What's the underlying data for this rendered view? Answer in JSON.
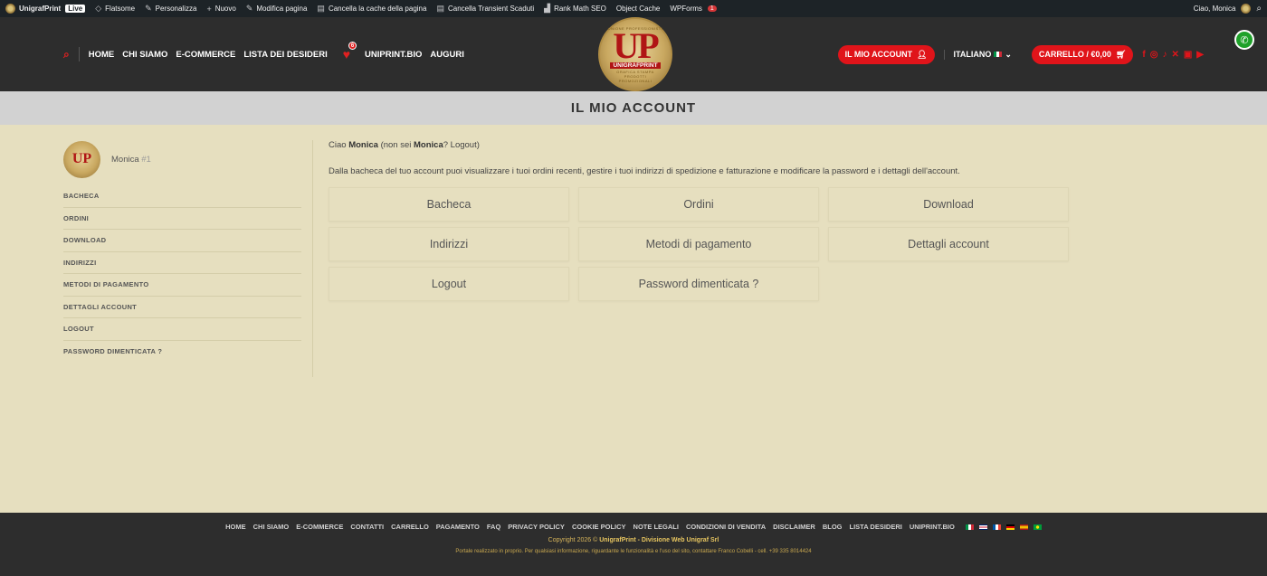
{
  "adminbar": {
    "site": "UnigrafPrint",
    "live": "Live",
    "items": [
      {
        "icon": "flatsome-icon",
        "glyph": "◇",
        "label": "Flatsome"
      },
      {
        "icon": "brush-icon",
        "glyph": "✎",
        "label": "Personalizza"
      },
      {
        "icon": "plus-icon",
        "glyph": "+",
        "label": "Nuovo"
      },
      {
        "icon": "pencil-icon",
        "glyph": "✎",
        "label": "Modifica pagina"
      },
      {
        "icon": "database-icon",
        "glyph": "▤",
        "label": "Cancella la cache della pagina"
      },
      {
        "icon": "database-icon",
        "glyph": "▤",
        "label": "Cancella Transient Scaduti"
      },
      {
        "icon": "rankmath-icon",
        "glyph": "▟",
        "label": "Rank Math SEO"
      },
      {
        "icon": "",
        "glyph": "",
        "label": "Object Cache"
      },
      {
        "icon": "",
        "glyph": "",
        "label": "WPForms"
      }
    ],
    "wpforms_badge": "1",
    "greeting": "Ciao, Monica"
  },
  "header": {
    "nav_left": [
      "HOME",
      "CHI SIAMO",
      "E-COMMERCE",
      "LISTA DEI DESIDERI"
    ],
    "wishlist_count": "6",
    "nav_right_links": [
      "UNIPRINT.BIO",
      "AUGURI"
    ],
    "logo": {
      "letters": "UP",
      "top": "UNIONE PROFESSIONISTI",
      "band": "UNIGRAFPRINT",
      "bottom": "GRAFICA STAMPA PRODOTTI PROMOZIONALI"
    },
    "account_label": "IL MIO ACCOUNT",
    "language": "ITALIANO",
    "cart_label": "CARRELLO / €0,00",
    "accent": "#e0141a"
  },
  "page": {
    "title": "IL MIO ACCOUNT"
  },
  "sidebar": {
    "user_name": "Monica",
    "user_id": "#1",
    "items": [
      "BACHECA",
      "ORDINI",
      "DOWNLOAD",
      "INDIRIZZI",
      "METODI DI PAGAMENTO",
      "DETTAGLI ACCOUNT",
      "LOGOUT",
      "PASSWORD DIMENTICATA ?"
    ]
  },
  "main": {
    "greeting_prefix": "Ciao",
    "name": "Monica",
    "greeting_mid": "(non sei",
    "name2": "Monica",
    "greeting_suffix": "? Logout)",
    "intro": "Dalla bacheca del tuo account puoi visualizzare i tuoi ordini recenti, gestire i tuoi indirizzi di spedizione e fatturazione e modificare la password e i dettagli dell'account.",
    "tiles": [
      "Bacheca",
      "Ordini",
      "Download",
      "Indirizzi",
      "Metodi di pagamento",
      "Dettagli account",
      "Logout",
      "Password dimenticata ?"
    ]
  },
  "footer": {
    "links": [
      "HOME",
      "CHI SIAMO",
      "E-COMMERCE",
      "CONTATTI",
      "CARRELLO",
      "PAGAMENTO",
      "FAQ",
      "PRIVACY POLICY",
      "COOKIE POLICY",
      "NOTE LEGALI",
      "CONDIZIONI DI VENDITA",
      "DISCLAIMER",
      "BLOG",
      "LISTA DESIDERI",
      "UNIPRINT.BIO"
    ],
    "copyright_prefix": "Copyright 2026 ©",
    "copyright_brand": "UnigrafPrint - Divisione Web Unigraf Srl",
    "portal_note": "Portale realizzato in proprio. Per qualsiasi informazione, riguardante le funzionalità e l'uso del sito, contattare Franco Cobelli - cell. +39 335 8014424"
  }
}
